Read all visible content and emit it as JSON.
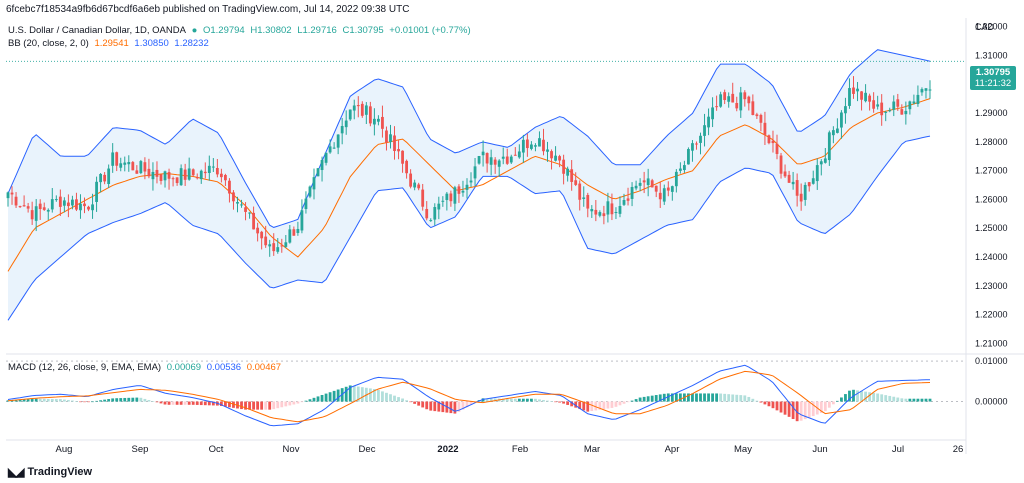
{
  "publisher_line": "6fcebc7f18534a9fb6d67bcdf6a6eb published on TradingView.com, Jul 14, 2022 09:38 UTC",
  "legend": {
    "symbol": "U.S. Dollar / Canadian Dollar, 1D, OANDA",
    "o": "O1.29794",
    "h": "H1.30802",
    "l": "L1.29716",
    "c": "C1.30795",
    "chg": "+0.01001 (+0.77%)",
    "bb_label": "BB (20, close, 2, 0)",
    "bb_basis": "1.29541",
    "bb_upper": "1.30850",
    "bb_lower": "1.28232",
    "macd_label": "MACD (12, 26, close, 9, EMA, EMA)",
    "macd_hist": "0.00069",
    "macd_line": "0.00536",
    "macd_signal": "0.00467"
  },
  "currency": "CAD",
  "price_tag": {
    "price": "1.30795",
    "countdown": "11:21:32"
  },
  "brand": "TradingView",
  "colors": {
    "up": "#26a69a",
    "down": "#ef5350",
    "bb": "#2962ff",
    "basis": "#ff6d00",
    "bb_fill": "#e3f0fb",
    "macd": "#2962ff",
    "signal": "#ff6d00"
  },
  "chart_data": [
    {
      "type": "candlestick",
      "title": "U.S. Dollar / Canadian Dollar, 1D, OANDA",
      "y_ticks": [
        "1.32000",
        "1.31000",
        "1.30000",
        "1.29000",
        "1.28000",
        "1.27000",
        "1.26000",
        "1.25000",
        "1.24000",
        "1.23000",
        "1.22000",
        "1.21000"
      ],
      "ylim": [
        1.207,
        1.323
      ],
      "x_ticks": [
        "Aug",
        "Sep",
        "Oct",
        "Nov",
        "Dec",
        "2022",
        "Feb",
        "Mar",
        "Apr",
        "May",
        "Jun",
        "Jul",
        "26"
      ],
      "anchors": [
        [
          1.25,
          1.275
        ],
        [
          1.257,
          1.253
        ],
        [
          1.262,
          1.258
        ],
        [
          1.255,
          1.26
        ],
        [
          1.262,
          1.286
        ],
        [
          1.274,
          1.267
        ],
        [
          1.27,
          1.266
        ],
        [
          1.262,
          1.275
        ],
        [
          1.281,
          1.261
        ],
        [
          1.266,
          1.244
        ],
        [
          1.242,
          1.241
        ],
        [
          1.247,
          1.255
        ],
        [
          1.263,
          1.285
        ],
        [
          1.286,
          1.298
        ],
        [
          1.294,
          1.283
        ],
        [
          1.276,
          1.267
        ],
        [
          1.259,
          1.25
        ],
        [
          1.258,
          1.267
        ],
        [
          1.273,
          1.276
        ],
        [
          1.274,
          1.276
        ],
        [
          1.279,
          1.285
        ],
        [
          1.283,
          1.264
        ],
        [
          1.26,
          1.251
        ],
        [
          1.253,
          1.262
        ],
        [
          1.265,
          1.268
        ],
        [
          1.268,
          1.254
        ],
        [
          1.272,
          1.283
        ],
        [
          1.287,
          1.3
        ],
        [
          1.305,
          1.284
        ],
        [
          1.282,
          1.274
        ],
        [
          1.264,
          1.255
        ],
        [
          1.261,
          1.292
        ],
        [
          1.3,
          1.298
        ],
        [
          1.29,
          1.292
        ],
        [
          1.287,
          1.297
        ],
        [
          1.306,
          1.296
        ]
      ],
      "ma_basis": [
        1.235,
        1.25,
        1.255,
        1.26,
        1.265,
        1.268,
        1.269,
        1.268,
        1.266,
        1.258,
        1.247,
        1.24,
        1.25,
        1.268,
        1.279,
        1.281,
        1.272,
        1.263,
        1.265,
        1.27,
        1.275,
        1.272,
        1.265,
        1.26,
        1.263,
        1.267,
        1.27,
        1.282,
        1.286,
        1.281,
        1.272,
        1.275,
        1.285,
        1.29,
        1.292,
        1.295
      ],
      "bb_upper": [
        1.262,
        1.283,
        1.275,
        1.275,
        1.285,
        1.284,
        1.279,
        1.288,
        1.283,
        1.266,
        1.25,
        1.253,
        1.275,
        1.296,
        1.302,
        1.299,
        1.281,
        1.276,
        1.28,
        1.278,
        1.285,
        1.289,
        1.282,
        1.272,
        1.272,
        1.282,
        1.29,
        1.307,
        1.307,
        1.3,
        1.283,
        1.289,
        1.304,
        1.312,
        1.31,
        1.308
      ],
      "bb_lower": [
        1.218,
        1.232,
        1.24,
        1.248,
        1.252,
        1.255,
        1.259,
        1.251,
        1.248,
        1.238,
        1.229,
        1.232,
        1.231,
        1.247,
        1.263,
        1.264,
        1.25,
        1.254,
        1.268,
        1.268,
        1.262,
        1.263,
        1.243,
        1.241,
        1.246,
        1.251,
        1.253,
        1.266,
        1.271,
        1.269,
        1.252,
        1.248,
        1.255,
        1.268,
        1.28,
        1.282
      ]
    },
    {
      "type": "macd",
      "title": "MACD (12, 26, close, 9, EMA, EMA)",
      "y_ticks": [
        "0.01000",
        "0.00000"
      ],
      "ylim": [
        -0.009,
        0.011
      ],
      "macd": [
        0.0005,
        0.0015,
        0.0018,
        0.0012,
        0.003,
        0.004,
        0.002,
        0.001,
        -0.0005,
        -0.0035,
        -0.006,
        -0.0055,
        -0.002,
        0.0035,
        0.006,
        0.0055,
        0.001,
        -0.0025,
        0.0005,
        0.0015,
        0.0025,
        0.0015,
        -0.003,
        -0.0045,
        -0.002,
        0.001,
        0.004,
        0.0075,
        0.009,
        0.005,
        -0.003,
        -0.0055,
        0.001,
        0.005,
        0.0052,
        0.0054
      ],
      "signal": [
        0.0002,
        0.0008,
        0.0012,
        0.0014,
        0.0022,
        0.003,
        0.0028,
        0.0018,
        0.0005,
        -0.0015,
        -0.004,
        -0.005,
        -0.0038,
        -0.0005,
        0.003,
        0.0048,
        0.0032,
        0.0005,
        -0.0003,
        0.0008,
        0.0018,
        0.0018,
        -0.0005,
        -0.003,
        -0.003,
        -0.001,
        0.002,
        0.0055,
        0.0075,
        0.0065,
        0.002,
        -0.003,
        -0.002,
        0.003,
        0.0045,
        0.0047
      ]
    }
  ]
}
